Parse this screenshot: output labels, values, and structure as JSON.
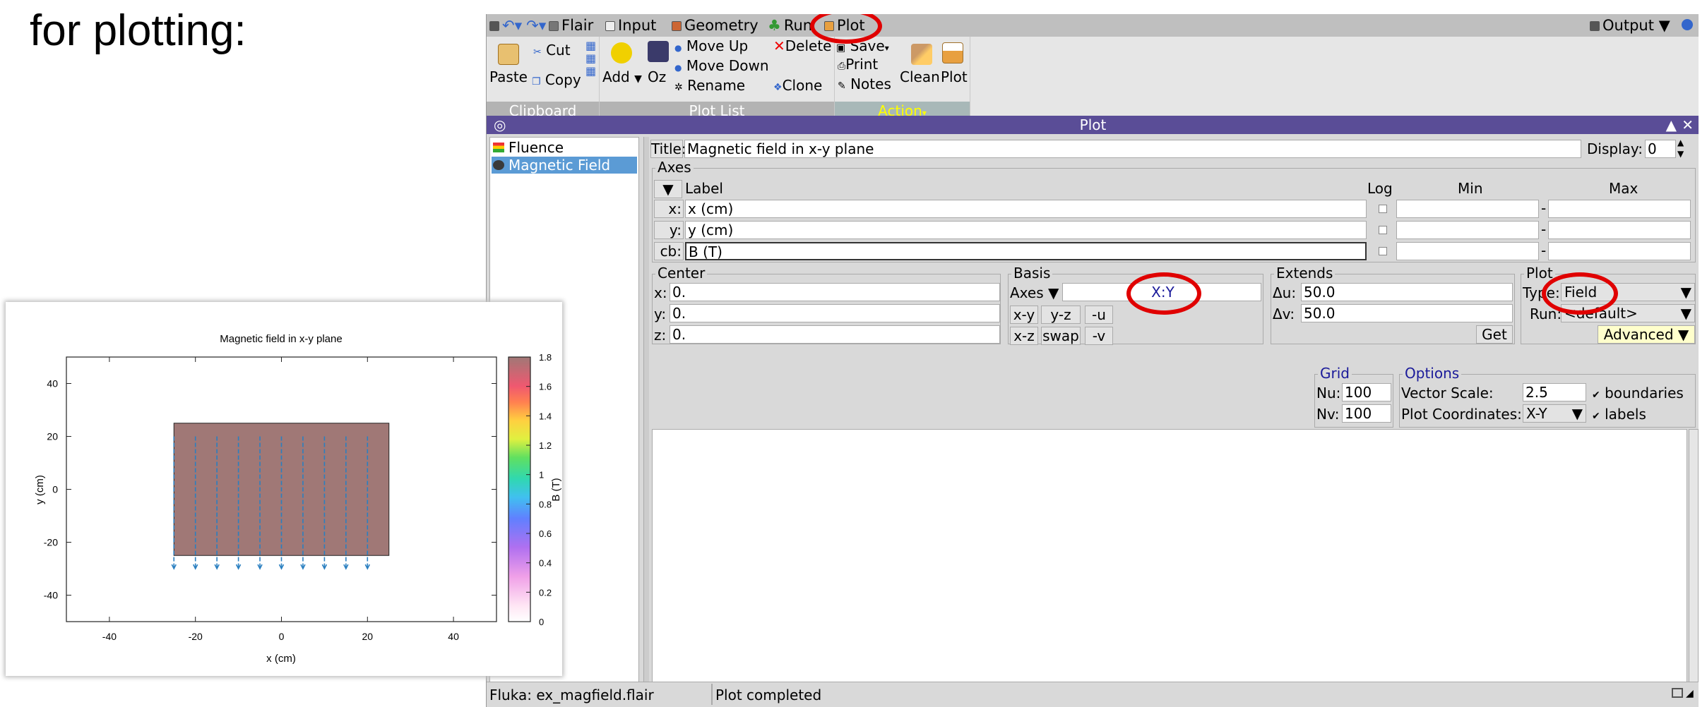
{
  "slide": {
    "heading": "for plotting:"
  },
  "menubar": {
    "items": [
      "Flair",
      "Input",
      "Geometry",
      "Run",
      "Plot"
    ],
    "output": "Output"
  },
  "ribbon": {
    "clipboard": {
      "paste": "Paste",
      "cut": "Cut",
      "copy": "Copy",
      "label": "Clipboard"
    },
    "plotlist": {
      "add": "Add",
      "oz": "Oz",
      "move_up": "Move Up",
      "move_down": "Move Down",
      "rename": "Rename",
      "delete": "Delete",
      "clone": "Clone",
      "label": "Plot List"
    },
    "action": {
      "save": "Save",
      "print": "Print",
      "notes": "Notes",
      "clean": "Clean",
      "plot": "Plot",
      "label": "Action"
    }
  },
  "dock": {
    "title": "Plot"
  },
  "plot_list": {
    "items": [
      "Fluence",
      "Magnetic Field"
    ],
    "selected": "Magnetic Field"
  },
  "panel": {
    "title_label": "Title:",
    "title_value": "Magnetic field in x-y plane",
    "display_label": "Display:",
    "display_value": "0",
    "axes": {
      "frame": "Axes",
      "col_label": "Label",
      "col_log": "Log",
      "col_min": "Min",
      "col_max": "Max",
      "rows": [
        {
          "name": "x:",
          "label": "x (cm)"
        },
        {
          "name": "y:",
          "label": "y (cm)"
        },
        {
          "name": "cb:",
          "label": "B (T)"
        }
      ]
    },
    "center": {
      "frame": "Center",
      "x_label": "x:",
      "x": "0.",
      "y_label": "y:",
      "y": "0.",
      "z_label": "z:",
      "z": "0."
    },
    "basis": {
      "frame": "Basis",
      "axes": "Axes",
      "value": "X:Y",
      "buttons": [
        "x-y",
        "y-z",
        "-u",
        "x-z",
        "swap",
        "-v"
      ]
    },
    "extends": {
      "frame": "Extends",
      "du_label": "Δu:",
      "du": "50.0",
      "dv_label": "Δv:",
      "dv": "50.0",
      "get": "Get"
    },
    "plot": {
      "frame": "Plot",
      "type_label": "Type:",
      "type": "Field",
      "run_label": "Run:",
      "run": "<default>",
      "advanced": "Advanced"
    },
    "grid": {
      "frame": "Grid",
      "nu_label": "Nu:",
      "nu": "100",
      "nv_label": "Nv:",
      "nv": "100"
    },
    "options": {
      "frame": "Options",
      "vector_scale_label": "Vector Scale:",
      "vector_scale": "2.5",
      "coords_label": "Plot Coordinates:",
      "coords": "X-Y",
      "boundaries": "boundaries",
      "labels": "labels"
    }
  },
  "status": {
    "file": "Fluka: ex_magfield.flair",
    "message": "Plot completed"
  },
  "colors": {
    "accent": "#5a4d97",
    "selection": "#5b9bd5",
    "highlight": "#e00000",
    "action_label": "#ffff00"
  },
  "chart_data": {
    "type": "heatmap",
    "title": "Magnetic field in x-y plane",
    "xlabel": "x (cm)",
    "ylabel": "y (cm)",
    "colorbar_label": "B (T)",
    "xlim": [
      -50,
      50
    ],
    "ylim": [
      -50,
      50
    ],
    "xticks": [
      -40,
      -20,
      0,
      20,
      40
    ],
    "yticks": [
      -40,
      -20,
      0,
      20,
      40
    ],
    "colorbar_range": [
      0,
      1.8
    ],
    "colorbar_ticks": [
      0,
      0.2,
      0.4,
      0.6,
      0.8,
      1,
      1.2,
      1.4,
      1.6,
      1.8
    ],
    "field_region": {
      "x": [
        -25,
        25
      ],
      "y": [
        -25,
        25
      ],
      "value": 1.8
    },
    "vectors": {
      "x": [
        -25,
        -20,
        -15,
        -10,
        -5,
        0,
        5,
        10,
        15,
        20
      ],
      "y_from": 20,
      "y_to": -30,
      "direction": "down"
    }
  }
}
